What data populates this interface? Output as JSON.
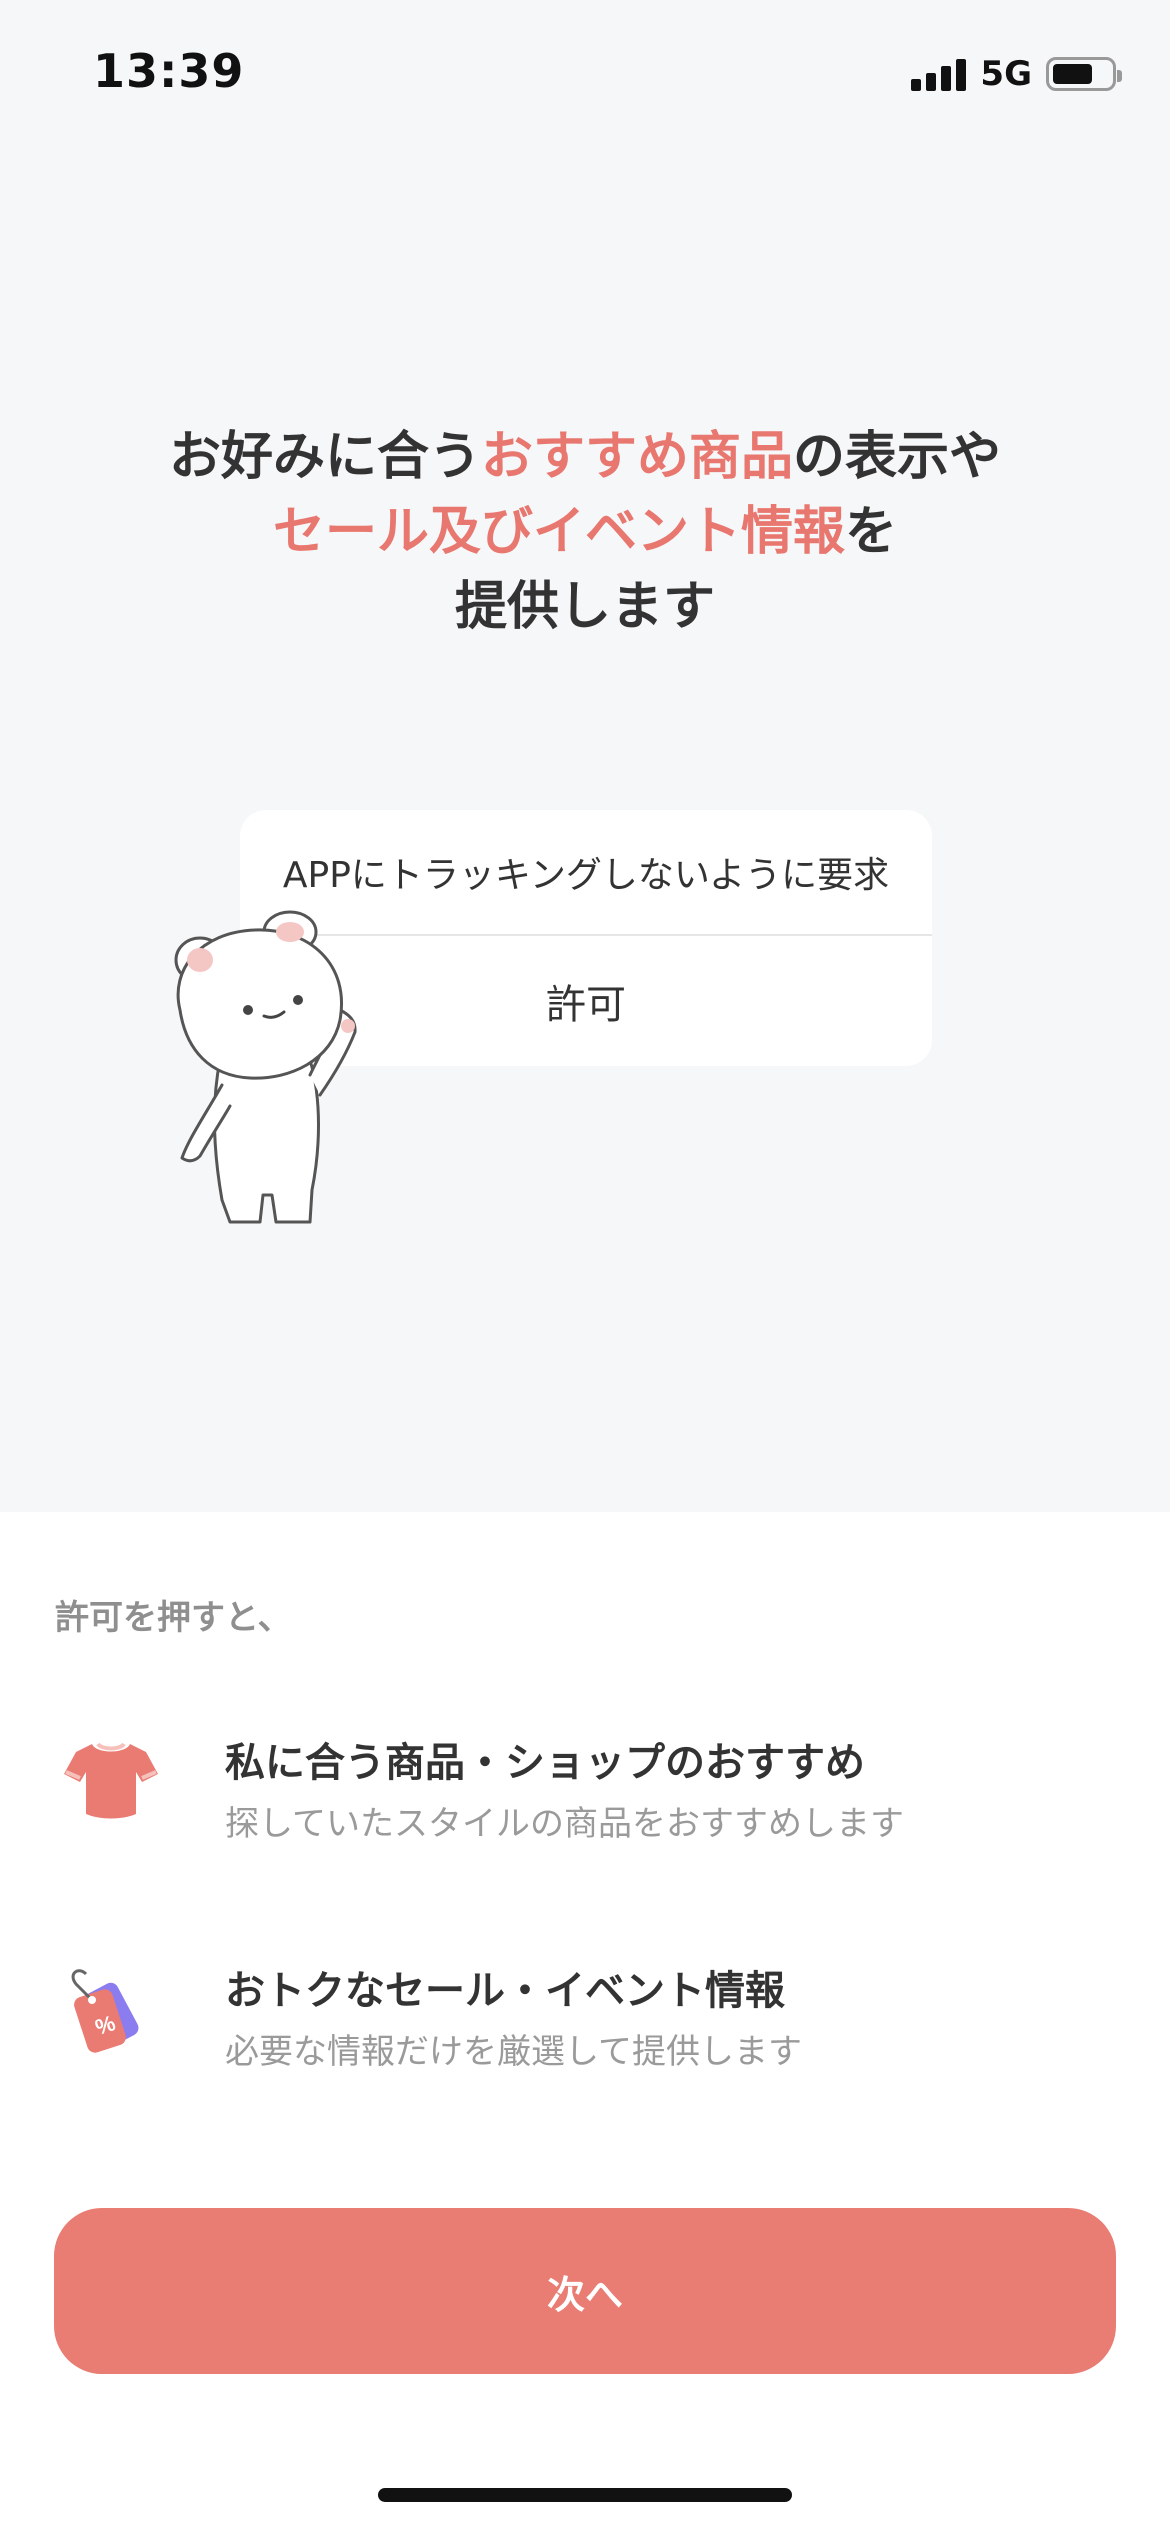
{
  "status_bar": {
    "time": "13:39",
    "network": "5G",
    "signal_bars": 4,
    "battery_level": 0.7
  },
  "headline": {
    "line1_pre": "お好みに合う",
    "line1_accent": "おすすめ商品",
    "line1_post": "の表示や",
    "line2_accent": "セール及びイベント情報",
    "line2_post": "を",
    "line3": "提供します"
  },
  "tracking_card": {
    "ask_not_to_track_label": "APPにトラッキングしないように要求",
    "allow_label": "許可"
  },
  "info": {
    "intro": "許可を押すと、",
    "features": [
      {
        "icon": "shirt-icon",
        "title": "私に合う商品・ショップのおすすめ",
        "description": "探していたスタイルの商品をおすすめします"
      },
      {
        "icon": "price-tag-icon",
        "title": "おトクなセール・イベント情報",
        "description": "必要な情報だけを厳選して提供します"
      }
    ]
  },
  "next_button_label": "次へ",
  "colors": {
    "accent": "#e8776f",
    "button": "#e97c73",
    "top_background": "#f6f7f9"
  }
}
